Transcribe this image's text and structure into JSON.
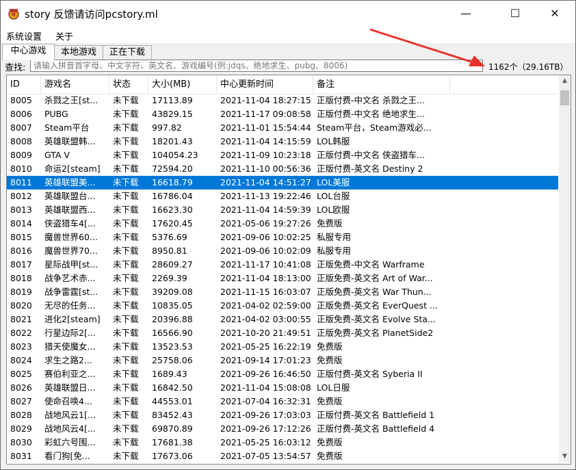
{
  "window": {
    "title": "story 反馈请访问pcstory.ml",
    "minimize_glyph": "—",
    "maximize_glyph": "☐",
    "close_glyph": "✕"
  },
  "menu": {
    "items": [
      "系统设置",
      "关于"
    ]
  },
  "tabs": [
    "中心游戏",
    "本地游戏",
    "正在下载"
  ],
  "search": {
    "label": "查找:",
    "placeholder": "请输入拼音首字母、中文字符、英文名、游戏编号(例:jdqs、绝地求生、pubg、8006)"
  },
  "summary": "1162个（29.16TB）",
  "table": {
    "columns": [
      "ID",
      "游戏名",
      "状态",
      "大小(MB)",
      "中心更新时间",
      "备注",
      ""
    ],
    "selected_id": "8011",
    "rows": [
      [
        "8005",
        "杀戮之王[st...",
        "未下载",
        "17113.89",
        "2021-11-04 18:27:15",
        "正版付费-中文名 杀戮之王..."
      ],
      [
        "8006",
        "PUBG",
        "未下载",
        "43829.15",
        "2021-11-17 09:08:58",
        "正版付费-中文名 绝地求生..."
      ],
      [
        "8007",
        "Steam平台",
        "未下载",
        "997.82",
        "2021-11-01 15:54:44",
        "Steam平台，Steam游戏必..."
      ],
      [
        "8008",
        "英雄联盟韩...",
        "未下载",
        "18201.43",
        "2021-11-04 14:15:59",
        "LOL韩服"
      ],
      [
        "8009",
        "GTA V",
        "未下载",
        "104054.23",
        "2021-11-09 10:23:18",
        "正版付费-中文名 侠盗猎车..."
      ],
      [
        "8010",
        "命运2[steam]",
        "未下载",
        "72594.20",
        "2021-11-10 00:56:36",
        "正版付费-英文名 Destiny 2"
      ],
      [
        "8011",
        "英雄联盟美...",
        "未下载",
        "16618.79",
        "2021-11-04 14:51:27",
        "LOL美服"
      ],
      [
        "8012",
        "英雄联盟台...",
        "未下载",
        "16786.04",
        "2021-11-13 19:22:46",
        "LOL台服"
      ],
      [
        "8013",
        "英雄联盟西...",
        "未下载",
        "16623.30",
        "2021-11-04 14:59:39",
        "LOL欧服"
      ],
      [
        "8014",
        "侠盗猎车4[...",
        "未下载",
        "17620.45",
        "2021-05-06 19:27:26",
        "免费版"
      ],
      [
        "8015",
        "魔兽世界60...",
        "未下载",
        "5376.69",
        "2021-09-06 10:02:25",
        "私服专用"
      ],
      [
        "8016",
        "魔兽世界70...",
        "未下载",
        "8950.81",
        "2021-09-06 10:02:09",
        "私服专用"
      ],
      [
        "8017",
        "星际战甲[st...",
        "未下载",
        "28609.27",
        "2021-11-17 10:41:08",
        "正版免费-中文名 Warframe"
      ],
      [
        "8018",
        "战争艺术赤...",
        "未下载",
        "2269.39",
        "2021-11-04 18:13:00",
        "正版免费-英文名 Art of War..."
      ],
      [
        "8019",
        "战争雷霆[st...",
        "未下载",
        "39209.08",
        "2021-11-15 16:03:07",
        "正版免费-英文名 War Thun..."
      ],
      [
        "8020",
        "无尽的任务...",
        "未下载",
        "10835.05",
        "2021-04-02 02:59:00",
        "正版免费-英文名 EverQuest ..."
      ],
      [
        "8021",
        "进化2[steam]",
        "未下载",
        "20396.88",
        "2021-04-02 03:00:55",
        "正版免费-英文名 Evolve Sta..."
      ],
      [
        "8022",
        "行星边际2[...",
        "未下载",
        "16566.90",
        "2021-10-20 21:49:51",
        "正版免费-英文名 PlanetSide2"
      ],
      [
        "8023",
        "猎天使魔女...",
        "未下载",
        "13523.53",
        "2021-05-25 16:22:19",
        "免费版"
      ],
      [
        "8024",
        "求生之路2...",
        "未下载",
        "25758.06",
        "2021-09-14 17:01:23",
        "免费版"
      ],
      [
        "8025",
        "赛伯利亚之...",
        "未下载",
        "1689.43",
        "2021-09-26 16:46:50",
        "正版付费-英文名 Syberia II"
      ],
      [
        "8026",
        "英雄联盟日...",
        "未下载",
        "16842.50",
        "2021-11-04 15:08:08",
        "LOL日服"
      ],
      [
        "8027",
        "使命召唤4...",
        "未下载",
        "44553.01",
        "2021-07-04 16:32:31",
        "免费版"
      ],
      [
        "8028",
        "战地风云1[...",
        "未下载",
        "83452.43",
        "2021-09-26 17:03:03",
        "正版付费-英文名 Battlefield 1"
      ],
      [
        "8029",
        "战地风云4[...",
        "未下载",
        "69870.89",
        "2021-09-26 17:12:26",
        "正版付费-英文名 Battlefield 4"
      ],
      [
        "8030",
        "彩虹六号围...",
        "未下载",
        "17681.38",
        "2021-05-25 16:03:12",
        "免费版"
      ],
      [
        "8031",
        "看门狗[免...",
        "未下载",
        "17673.06",
        "2021-07-05 13:54:57",
        "免费版"
      ]
    ]
  },
  "colors": {
    "selection": "#0078d7",
    "annotation_arrow": "#e8322b"
  }
}
